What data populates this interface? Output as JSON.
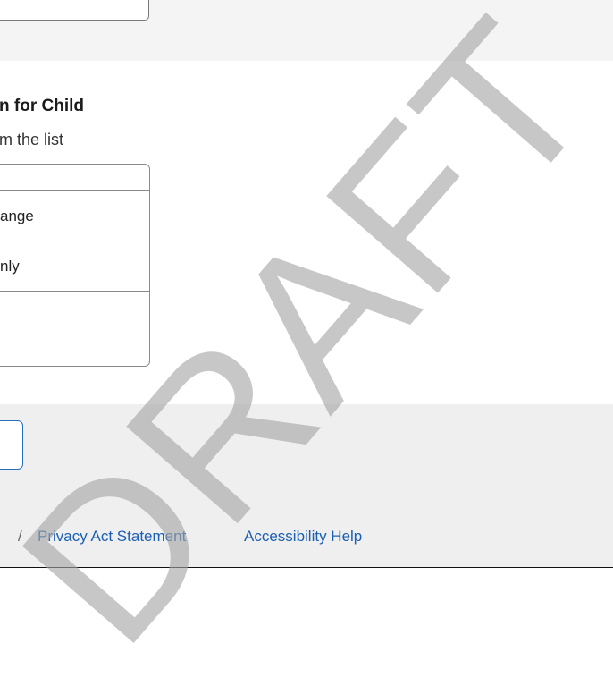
{
  "section": {
    "title": "n for Child",
    "hint": "m the list"
  },
  "options": [
    {
      "label": ""
    },
    {
      "label": "ange"
    },
    {
      "label": "nly"
    },
    {
      "label": ""
    }
  ],
  "footer": {
    "separator": "/",
    "links": [
      {
        "label": "Privacy Act Statement"
      },
      {
        "label": "Accessibility Help"
      }
    ]
  },
  "watermark": {
    "text": "DRAFT"
  }
}
